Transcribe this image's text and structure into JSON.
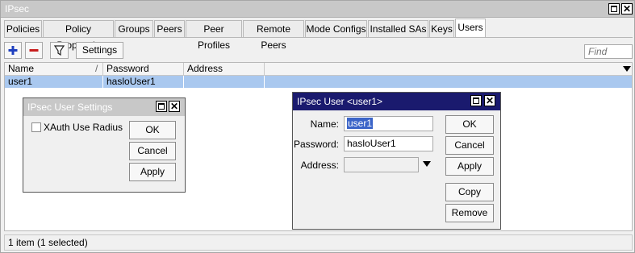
{
  "window": {
    "title": "IPsec"
  },
  "tabs": [
    {
      "label": "Policies"
    },
    {
      "label": "Policy Proposals"
    },
    {
      "label": "Groups"
    },
    {
      "label": "Peers"
    },
    {
      "label": "Peer Profiles"
    },
    {
      "label": "Remote Peers"
    },
    {
      "label": "Mode Configs"
    },
    {
      "label": "Installed SAs"
    },
    {
      "label": "Keys"
    },
    {
      "label": "Users"
    }
  ],
  "active_tab": "Users",
  "toolbar": {
    "settings_label": "Settings",
    "find_placeholder": "Find"
  },
  "table": {
    "columns": [
      "Name",
      "Password",
      "Address"
    ],
    "sort_indicator": "/",
    "rows": [
      {
        "name": "user1",
        "password": "hasloUser1",
        "address": ""
      }
    ]
  },
  "status": {
    "text": "1 item (1 selected)"
  },
  "settings_dialog": {
    "title": "IPsec User Settings",
    "checkbox_label": "XAuth Use Radius",
    "ok": "OK",
    "cancel": "Cancel",
    "apply": "Apply"
  },
  "user_dialog": {
    "title": "IPsec User <user1>",
    "name_label": "Name:",
    "name_value": "user1",
    "password_label": "Password:",
    "password_value": "hasloUser1",
    "address_label": "Address:",
    "address_value": "",
    "ok": "OK",
    "cancel": "Cancel",
    "apply": "Apply",
    "copy": "Copy",
    "remove": "Remove"
  },
  "colors": {
    "titlebar_inactive": "#c8c8c8",
    "titlebar_active": "#1a1a6e",
    "selection": "#a9c8ef",
    "add_icon": "#1f3fbf",
    "remove_icon": "#c81e1e"
  },
  "icons": [
    "plus-icon",
    "minus-icon",
    "filter-icon",
    "maximize-icon",
    "close-icon",
    "dropdown-arrow-icon"
  ]
}
